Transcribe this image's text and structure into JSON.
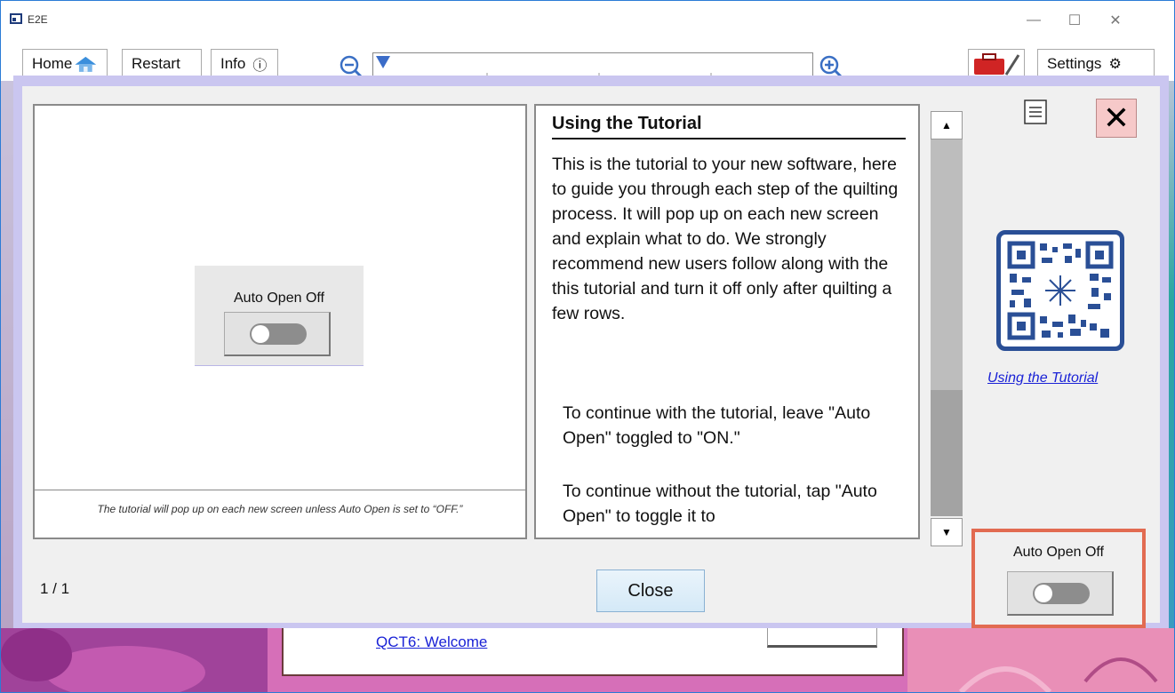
{
  "window": {
    "title": "E2E",
    "minimize": "—",
    "maximize": "☐",
    "close": "✕"
  },
  "toolbar": {
    "home_label": "Home",
    "restart_label": "Restart",
    "info_label": "Info",
    "info_glyph": "ⓘ",
    "settings_label": "Settings",
    "settings_glyph": "⚙"
  },
  "preview": {
    "toggle_label": "Auto Open Off",
    "caption": "The tutorial will pop up on each new screen unless Auto Open is set to “OFF.”"
  },
  "tutorial": {
    "title": "Using the Tutorial",
    "paragraph1": "This is the tutorial to your new software, here to guide you through each step of the quilting process. It will pop up on each new screen and explain what to do. We strongly recommend new users follow along with the this tutorial and turn it off only after quilting a few rows.",
    "paragraph2": "To continue with the tutorial, leave \"Auto Open\" toggled to \"ON.\"",
    "paragraph3": "To continue without the tutorial, tap \"Auto Open\" to toggle it to"
  },
  "scroll": {
    "up_glyph": "▲",
    "down_glyph": "▼"
  },
  "sidebar": {
    "close_glyph": "✕",
    "qr_link": "Using the Tutorial"
  },
  "footer": {
    "page_indicator": "1 / 1",
    "close_label": "Close",
    "auto_open_label": "Auto Open Off"
  },
  "background": {
    "link_text": "QCT6: Welcome"
  },
  "colors": {
    "accent": "#2b7bd6",
    "overlay": "#cac6f0",
    "highlight": "#e26b51",
    "link": "#1a22d6"
  }
}
